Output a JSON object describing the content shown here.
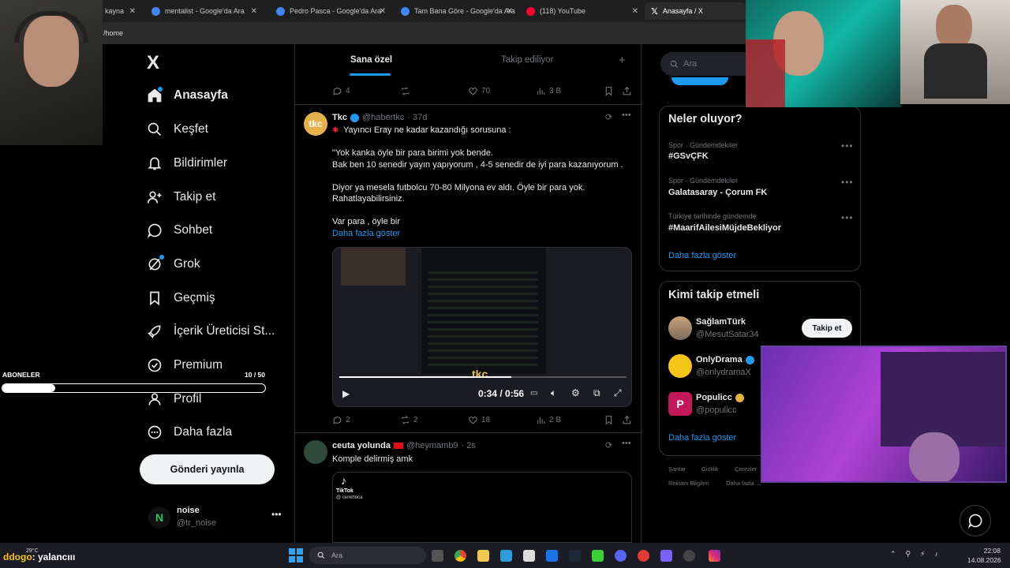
{
  "browser": {
    "tabs": [
      {
        "title": "k kayna",
        "fav": "#888888"
      },
      {
        "title": "mentalist - Google'da Ara",
        "fav": "#4285f4"
      },
      {
        "title": "Pedro Pasca - Google'da Ara",
        "fav": "#4285f4"
      },
      {
        "title": "Tam Bana Göre - Google'da Ara",
        "fav": "#4285f4"
      },
      {
        "title": "(118) YouTube",
        "fav": "#ff0033"
      },
      {
        "title": "Anasayfa / X",
        "fav": "#ffffff"
      }
    ],
    "address": "/home"
  },
  "nav": {
    "logo": "X",
    "items": [
      {
        "label": "Anasayfa",
        "icon": "home-icon"
      },
      {
        "label": "Keşfet",
        "icon": "search-icon"
      },
      {
        "label": "Bildirimler",
        "icon": "bell-icon"
      },
      {
        "label": "Takip et",
        "icon": "add-person-icon"
      },
      {
        "label": "Sohbet",
        "icon": "chat-icon"
      },
      {
        "label": "Grok",
        "icon": "grok-icon"
      },
      {
        "label": "Geçmiş",
        "icon": "bookmark-icon"
      },
      {
        "label": "İçerik Üreticisi St...",
        "icon": "rocket-icon"
      },
      {
        "label": "Premium",
        "icon": "verified-icon"
      },
      {
        "label": "Profil",
        "icon": "person-icon"
      },
      {
        "label": "Daha fazla",
        "icon": "more-circle-icon"
      }
    ],
    "post_button": "Gönderi yayınla",
    "account": {
      "name": "noise",
      "handle": "@tr_noise",
      "avatar_letter": "N"
    }
  },
  "timeline": {
    "tabs": [
      "Sana özel",
      "Takip ediliyor"
    ],
    "prev_tweet_actions": {
      "replies": "4",
      "retweets": "",
      "likes": "70",
      "views": "3 B"
    },
    "tweet1": {
      "name": "Tkc",
      "handle": "@habertkc",
      "time": "· 37d",
      "avatar": "tkc",
      "text": "Yayıncı Eray ne kadar kazandığı sorusuna :\n\n\"Yok kanka öyle bir para birimi yok bende.\nBak ben 10 senedir yayın yapıyorum , 4-5 senedir de iyi para kazanıyorum .\n\nDiyor ya mesela futbolcu 70-80 Milyona ev aldı. Öyle bir para yok.\nRahatlayabilirsiniz.\n\nVar para , öyle bir",
      "show_more": "Daha fazla göster",
      "video_time": "0:34 / 0:56",
      "video_logo": "tkc",
      "actions": {
        "replies": "2",
        "retweets": "2",
        "likes": "18",
        "views": "2 B"
      }
    },
    "tweet2": {
      "name": "ceuta yolunda",
      "handle": "@heymamb9",
      "time": "· 2s",
      "text": "Komple delirmiş amk",
      "embed_brand": "TikTok",
      "embed_user": "@ cenkhoca"
    }
  },
  "right": {
    "search_placeholder": "Ara",
    "whats_happening": {
      "title": "Neler oluyor?",
      "trends": [
        {
          "meta": "Spor · Gündemdekiler",
          "title": "#GSvÇFK"
        },
        {
          "meta": "Spor · Gündemdekiler",
          "title": "Galatasaray - Çorum FK"
        },
        {
          "meta": "Türkiye tarihinde gündemde",
          "title": "#MaarifAilesiMüjdeBekliyor"
        }
      ],
      "show_more": "Daha fazla göster"
    },
    "who_to_follow": {
      "title": "Kimi takip etmeli",
      "accounts": [
        {
          "name": "SağlamTürk",
          "handle": "@MesutSatar34",
          "verified": false
        },
        {
          "name": "OnlyDrama",
          "handle": "@onlydramaX",
          "verified": true
        },
        {
          "name": "Populicc",
          "handle": "@populicc",
          "verified": true
        }
      ],
      "follow_label": "Takip et",
      "show_more": "Daha fazla göster"
    },
    "footer": [
      "Şartlar",
      "Gizlilik",
      "Çerezler",
      "Reklam Bilgileri",
      "Daha fazla ..."
    ]
  },
  "overlay": {
    "subs_label": "ABONELER",
    "subs_count": "10 / 50",
    "subs_progress": 0.2,
    "donor": "ddogo",
    "donor_msg": ": yalancııı",
    "weather": "29°C"
  },
  "taskbar": {
    "search": "Ara",
    "time": "22:08",
    "date": "14.08.2026"
  },
  "colors": {
    "accent": "#1d9bf0",
    "bg": "#000000",
    "border": "#2f3336",
    "muted": "#71767b"
  }
}
